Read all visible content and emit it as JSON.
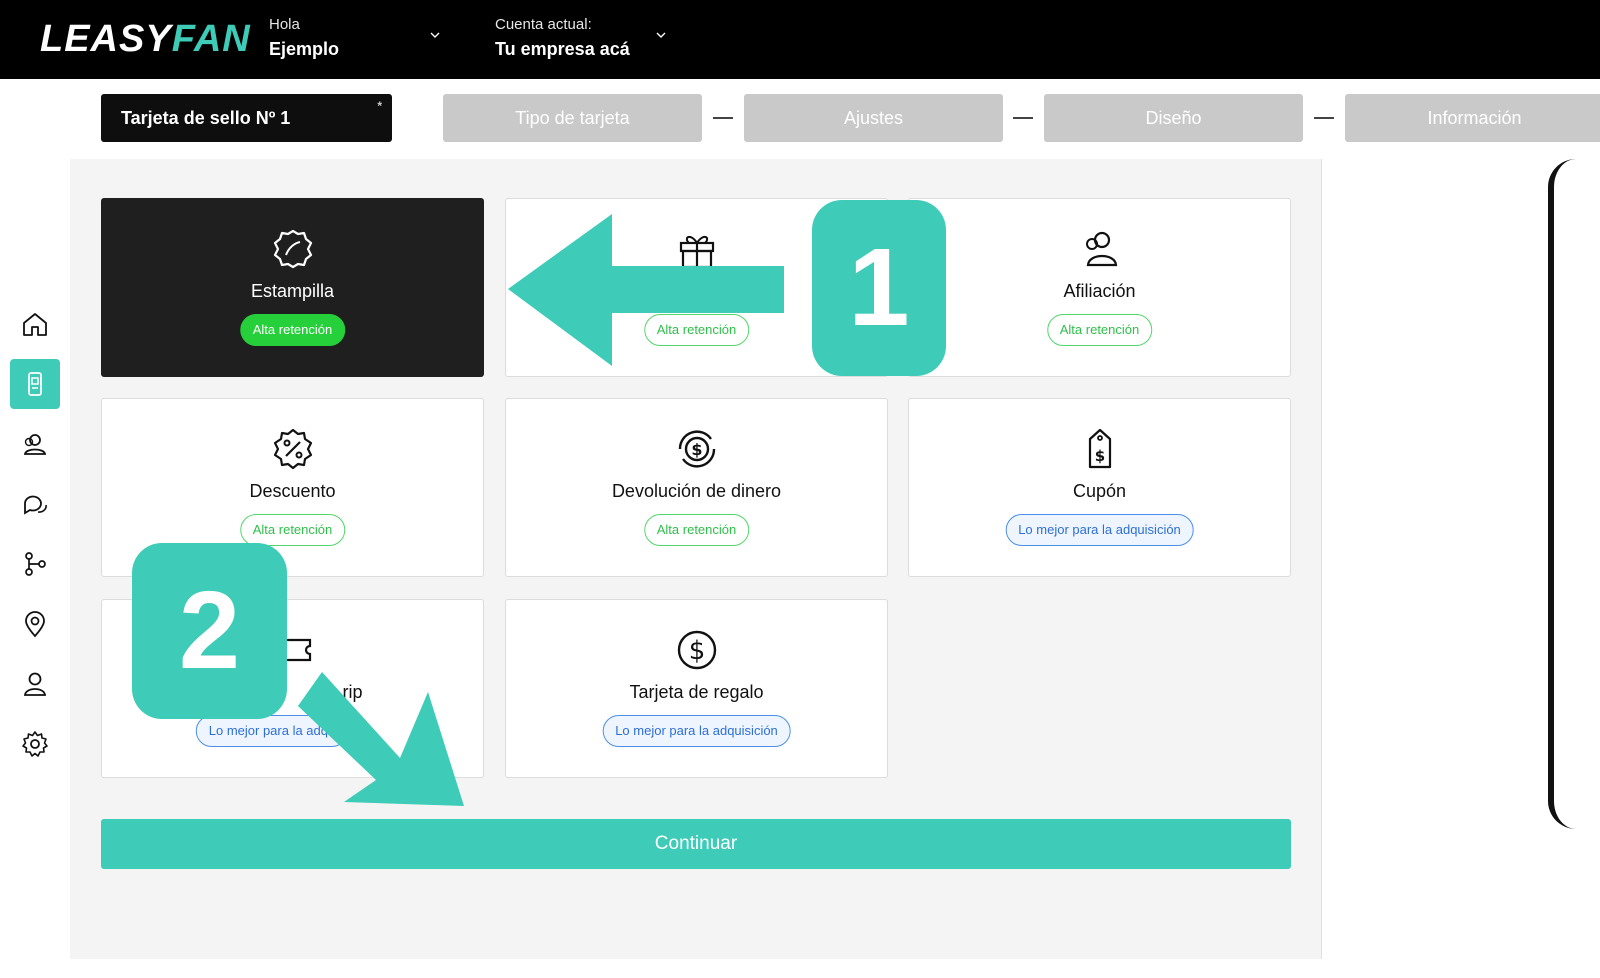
{
  "header": {
    "logo_part1": "LEASY",
    "logo_part2": "FAN",
    "greeting_label": "Hola",
    "greeting_name": "Ejemplo",
    "account_label": "Cuenta actual:",
    "account_name": "Tu empresa acá"
  },
  "stepper": {
    "card_name": "Tarjeta de sello Nº 1",
    "card_name_marker": "*",
    "steps": [
      "Tipo de tarjeta",
      "Ajustes",
      "Diseño",
      "Información"
    ]
  },
  "sidebar": {
    "items": [
      {
        "icon": "home-icon"
      },
      {
        "icon": "card-icon",
        "active": true
      },
      {
        "icon": "users-icon"
      },
      {
        "icon": "chat-icon"
      },
      {
        "icon": "flow-icon"
      },
      {
        "icon": "location-pin-icon"
      },
      {
        "icon": "user-icon"
      },
      {
        "icon": "gear-icon"
      }
    ]
  },
  "options": [
    {
      "title": "Estampilla",
      "badge": "Alta retención",
      "icon": "stamp-icon"
    },
    {
      "title": "",
      "badge": "Alta retención",
      "icon": "gift-icon"
    },
    {
      "title": "Afiliación",
      "badge": "Alta retención",
      "icon": "membership-icon"
    },
    {
      "title": "Descuento",
      "badge": "Alta retención",
      "icon": "discount-icon"
    },
    {
      "title": "Devolución de dinero",
      "badge": "Alta retención",
      "icon": "cashback-icon"
    },
    {
      "title": "Cupón",
      "badge": "Lo mejor para la adquisición",
      "icon": "coupon-tag-icon"
    },
    {
      "title": "rip",
      "badge": "Lo mejor para la adqu",
      "icon": "ticket-icon"
    },
    {
      "title": "Tarjeta de regalo",
      "badge": "Lo mejor para la adquisición",
      "icon": "dollar-coin-icon"
    }
  ],
  "continue_label": "Continuar",
  "annotations": {
    "step1": "1",
    "step2": "2"
  },
  "colors": {
    "accent": "#3ecbb8",
    "topbar": "#000000",
    "badge_green": "#25d03a",
    "badge_blue": "#4d8fe8"
  }
}
